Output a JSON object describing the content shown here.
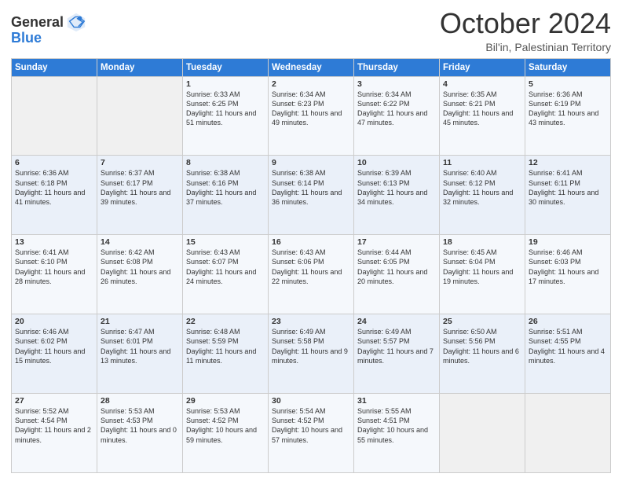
{
  "logo": {
    "line1": "General",
    "line2": "Blue"
  },
  "title": "October 2024",
  "location": "Bil'in, Palestinian Territory",
  "days_of_week": [
    "Sunday",
    "Monday",
    "Tuesday",
    "Wednesday",
    "Thursday",
    "Friday",
    "Saturday"
  ],
  "weeks": [
    [
      {
        "day": "",
        "sunrise": "",
        "sunset": "",
        "daylight": ""
      },
      {
        "day": "",
        "sunrise": "",
        "sunset": "",
        "daylight": ""
      },
      {
        "day": "1",
        "sunrise": "Sunrise: 6:33 AM",
        "sunset": "Sunset: 6:25 PM",
        "daylight": "Daylight: 11 hours and 51 minutes."
      },
      {
        "day": "2",
        "sunrise": "Sunrise: 6:34 AM",
        "sunset": "Sunset: 6:23 PM",
        "daylight": "Daylight: 11 hours and 49 minutes."
      },
      {
        "day": "3",
        "sunrise": "Sunrise: 6:34 AM",
        "sunset": "Sunset: 6:22 PM",
        "daylight": "Daylight: 11 hours and 47 minutes."
      },
      {
        "day": "4",
        "sunrise": "Sunrise: 6:35 AM",
        "sunset": "Sunset: 6:21 PM",
        "daylight": "Daylight: 11 hours and 45 minutes."
      },
      {
        "day": "5",
        "sunrise": "Sunrise: 6:36 AM",
        "sunset": "Sunset: 6:19 PM",
        "daylight": "Daylight: 11 hours and 43 minutes."
      }
    ],
    [
      {
        "day": "6",
        "sunrise": "Sunrise: 6:36 AM",
        "sunset": "Sunset: 6:18 PM",
        "daylight": "Daylight: 11 hours and 41 minutes."
      },
      {
        "day": "7",
        "sunrise": "Sunrise: 6:37 AM",
        "sunset": "Sunset: 6:17 PM",
        "daylight": "Daylight: 11 hours and 39 minutes."
      },
      {
        "day": "8",
        "sunrise": "Sunrise: 6:38 AM",
        "sunset": "Sunset: 6:16 PM",
        "daylight": "Daylight: 11 hours and 37 minutes."
      },
      {
        "day": "9",
        "sunrise": "Sunrise: 6:38 AM",
        "sunset": "Sunset: 6:14 PM",
        "daylight": "Daylight: 11 hours and 36 minutes."
      },
      {
        "day": "10",
        "sunrise": "Sunrise: 6:39 AM",
        "sunset": "Sunset: 6:13 PM",
        "daylight": "Daylight: 11 hours and 34 minutes."
      },
      {
        "day": "11",
        "sunrise": "Sunrise: 6:40 AM",
        "sunset": "Sunset: 6:12 PM",
        "daylight": "Daylight: 11 hours and 32 minutes."
      },
      {
        "day": "12",
        "sunrise": "Sunrise: 6:41 AM",
        "sunset": "Sunset: 6:11 PM",
        "daylight": "Daylight: 11 hours and 30 minutes."
      }
    ],
    [
      {
        "day": "13",
        "sunrise": "Sunrise: 6:41 AM",
        "sunset": "Sunset: 6:10 PM",
        "daylight": "Daylight: 11 hours and 28 minutes."
      },
      {
        "day": "14",
        "sunrise": "Sunrise: 6:42 AM",
        "sunset": "Sunset: 6:08 PM",
        "daylight": "Daylight: 11 hours and 26 minutes."
      },
      {
        "day": "15",
        "sunrise": "Sunrise: 6:43 AM",
        "sunset": "Sunset: 6:07 PM",
        "daylight": "Daylight: 11 hours and 24 minutes."
      },
      {
        "day": "16",
        "sunrise": "Sunrise: 6:43 AM",
        "sunset": "Sunset: 6:06 PM",
        "daylight": "Daylight: 11 hours and 22 minutes."
      },
      {
        "day": "17",
        "sunrise": "Sunrise: 6:44 AM",
        "sunset": "Sunset: 6:05 PM",
        "daylight": "Daylight: 11 hours and 20 minutes."
      },
      {
        "day": "18",
        "sunrise": "Sunrise: 6:45 AM",
        "sunset": "Sunset: 6:04 PM",
        "daylight": "Daylight: 11 hours and 19 minutes."
      },
      {
        "day": "19",
        "sunrise": "Sunrise: 6:46 AM",
        "sunset": "Sunset: 6:03 PM",
        "daylight": "Daylight: 11 hours and 17 minutes."
      }
    ],
    [
      {
        "day": "20",
        "sunrise": "Sunrise: 6:46 AM",
        "sunset": "Sunset: 6:02 PM",
        "daylight": "Daylight: 11 hours and 15 minutes."
      },
      {
        "day": "21",
        "sunrise": "Sunrise: 6:47 AM",
        "sunset": "Sunset: 6:01 PM",
        "daylight": "Daylight: 11 hours and 13 minutes."
      },
      {
        "day": "22",
        "sunrise": "Sunrise: 6:48 AM",
        "sunset": "Sunset: 5:59 PM",
        "daylight": "Daylight: 11 hours and 11 minutes."
      },
      {
        "day": "23",
        "sunrise": "Sunrise: 6:49 AM",
        "sunset": "Sunset: 5:58 PM",
        "daylight": "Daylight: 11 hours and 9 minutes."
      },
      {
        "day": "24",
        "sunrise": "Sunrise: 6:49 AM",
        "sunset": "Sunset: 5:57 PM",
        "daylight": "Daylight: 11 hours and 7 minutes."
      },
      {
        "day": "25",
        "sunrise": "Sunrise: 6:50 AM",
        "sunset": "Sunset: 5:56 PM",
        "daylight": "Daylight: 11 hours and 6 minutes."
      },
      {
        "day": "26",
        "sunrise": "Sunrise: 5:51 AM",
        "sunset": "Sunset: 4:55 PM",
        "daylight": "Daylight: 11 hours and 4 minutes."
      }
    ],
    [
      {
        "day": "27",
        "sunrise": "Sunrise: 5:52 AM",
        "sunset": "Sunset: 4:54 PM",
        "daylight": "Daylight: 11 hours and 2 minutes."
      },
      {
        "day": "28",
        "sunrise": "Sunrise: 5:53 AM",
        "sunset": "Sunset: 4:53 PM",
        "daylight": "Daylight: 11 hours and 0 minutes."
      },
      {
        "day": "29",
        "sunrise": "Sunrise: 5:53 AM",
        "sunset": "Sunset: 4:52 PM",
        "daylight": "Daylight: 10 hours and 59 minutes."
      },
      {
        "day": "30",
        "sunrise": "Sunrise: 5:54 AM",
        "sunset": "Sunset: 4:52 PM",
        "daylight": "Daylight: 10 hours and 57 minutes."
      },
      {
        "day": "31",
        "sunrise": "Sunrise: 5:55 AM",
        "sunset": "Sunset: 4:51 PM",
        "daylight": "Daylight: 10 hours and 55 minutes."
      },
      {
        "day": "",
        "sunrise": "",
        "sunset": "",
        "daylight": ""
      },
      {
        "day": "",
        "sunrise": "",
        "sunset": "",
        "daylight": ""
      }
    ]
  ]
}
